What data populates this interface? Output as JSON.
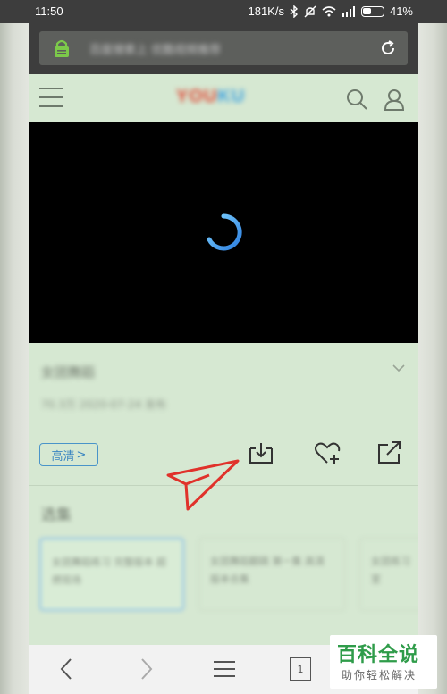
{
  "status_bar": {
    "time": "11:50",
    "network_speed": "181K/s",
    "battery": "41%"
  },
  "address_bar": {
    "url_text": "百度搜索上 优酷视频推荐"
  },
  "site_header": {
    "logo_text_a": "YOU",
    "logo_text_b": "KU"
  },
  "video_info": {
    "title": "女团舞蹈",
    "subtitle": "70.3万    2020-07-24 发布"
  },
  "actions": {
    "hd_label": "高清",
    "hd_chevron": ">"
  },
  "section": {
    "title": "选集",
    "cards": [
      {
        "text": "女团舞蹈练习 完整版本 超燃现场"
      },
      {
        "text": "女团舞蹈翻跳 第一集 高清版本合集"
      },
      {
        "text": "女团练习室"
      }
    ]
  },
  "bottom_nav": {
    "tab_count": "1"
  },
  "watermark": {
    "title": "百科全说",
    "subtitle": "助你轻松解决"
  },
  "colors": {
    "page_bg": "#d6e8d2",
    "accent_blue": "#3b86c1",
    "arrow_red": "#e0322b",
    "watermark_green": "#2f9c4a"
  }
}
